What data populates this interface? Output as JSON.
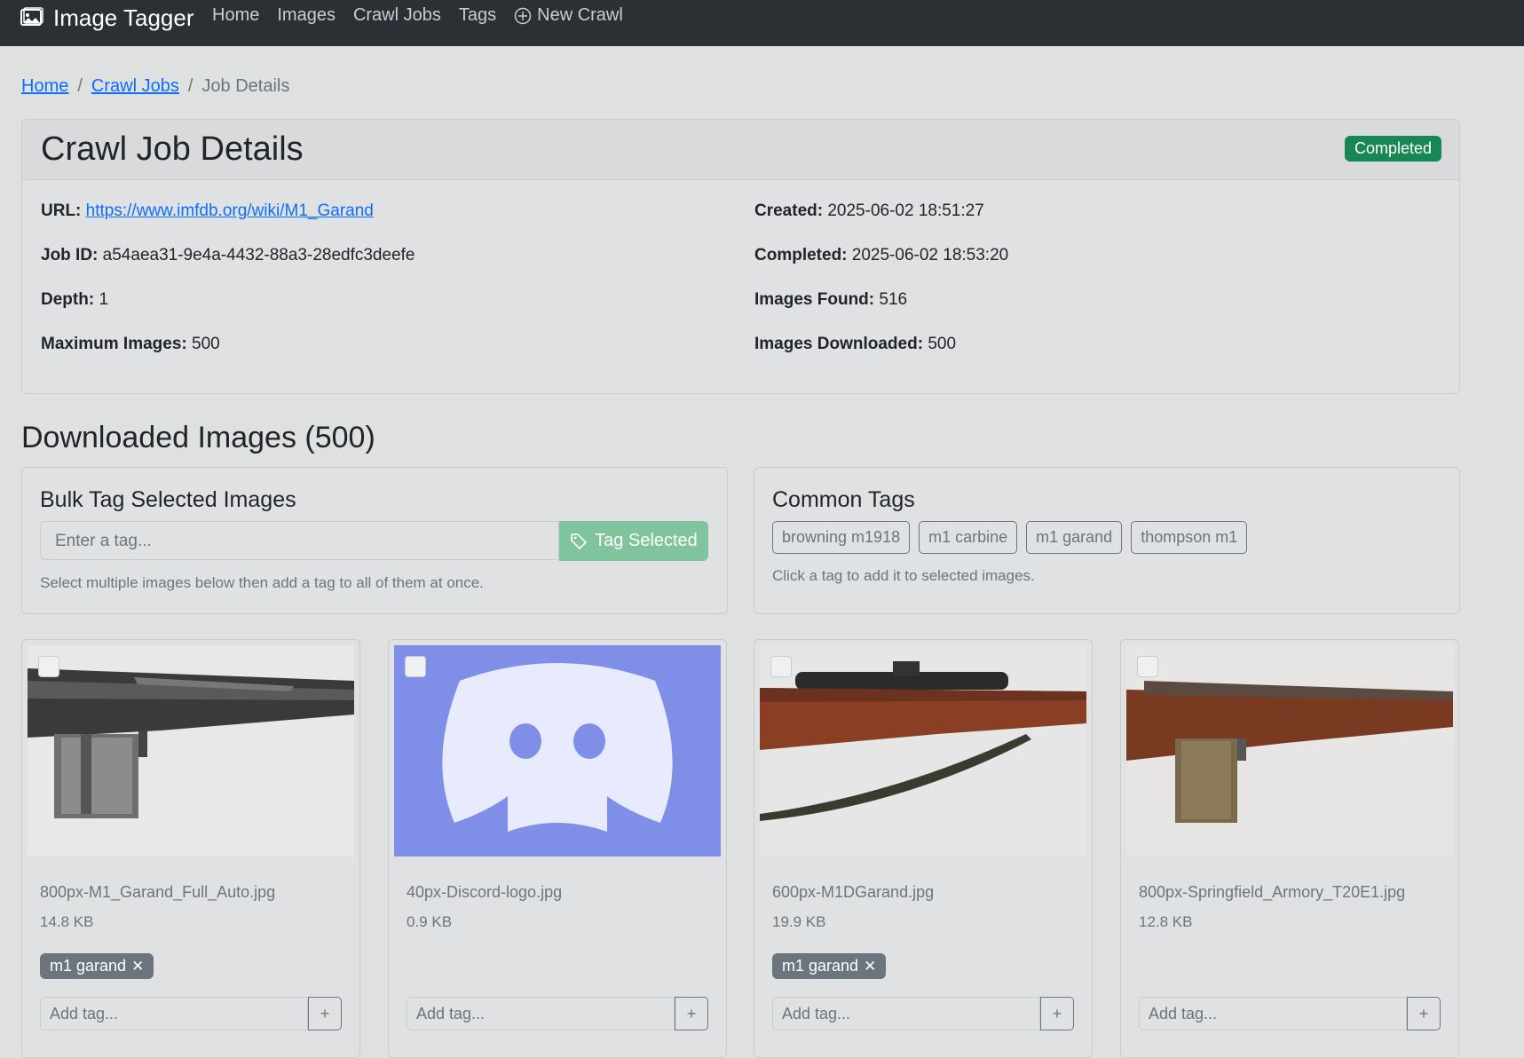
{
  "navbar": {
    "brand": "Image Tagger",
    "links": [
      "Home",
      "Images",
      "Crawl Jobs",
      "Tags"
    ],
    "new_crawl": "New Crawl"
  },
  "breadcrumb": {
    "home": "Home",
    "sep": "/",
    "crawl_jobs": "Crawl Jobs",
    "current": "Job Details"
  },
  "details": {
    "title": "Crawl Job Details",
    "status": "Completed",
    "status_color": "#198754",
    "url_label": "URL:",
    "url": "https://www.imfdb.org/wiki/M1_Garand",
    "job_id_label": "Job ID:",
    "job_id": "a54aea31-9e4a-4432-88a3-28edfc3deefe",
    "depth_label": "Depth:",
    "depth": "1",
    "max_images_label": "Maximum Images:",
    "max_images": "500",
    "created_label": "Created:",
    "created": "2025-06-02 18:51:27",
    "completed_label": "Completed:",
    "completed": "2025-06-02 18:53:20",
    "images_found_label": "Images Found:",
    "images_found": "516",
    "images_downloaded_label": "Images Downloaded:",
    "images_downloaded": "500"
  },
  "images_section_title": "Downloaded Images (500)",
  "bulk": {
    "title": "Bulk Tag Selected Images",
    "placeholder": "Enter a tag...",
    "button": "Tag Selected",
    "help": "Select multiple images below then add a tag to all of them at once."
  },
  "common": {
    "title": "Common Tags",
    "tags": [
      "browning m1918",
      "m1 carbine",
      "m1 garand",
      "thompson m1"
    ],
    "help": "Click a tag to add it to selected images."
  },
  "images": [
    {
      "filename": "800px-M1_Garand_Full_Auto.jpg",
      "size": "14.8 KB",
      "tag": "m1 garand",
      "thumb_icon": "rifle-photo-bw"
    },
    {
      "filename": "40px-Discord-logo.jpg",
      "size": "0.9 KB",
      "tag": "",
      "thumb_icon": "discord-logo"
    },
    {
      "filename": "600px-M1DGarand.jpg",
      "size": "19.9 KB",
      "tag": "m1 garand",
      "thumb_icon": "scoped-rifle-photo"
    },
    {
      "filename": "800px-Springfield_Armory_T20E1.jpg",
      "size": "12.8 KB",
      "tag": "",
      "thumb_icon": "rifle-photo"
    }
  ],
  "add_tag_placeholder": "Add tag...",
  "add_tag_button": "+",
  "remove_tag_glyph": "✕"
}
